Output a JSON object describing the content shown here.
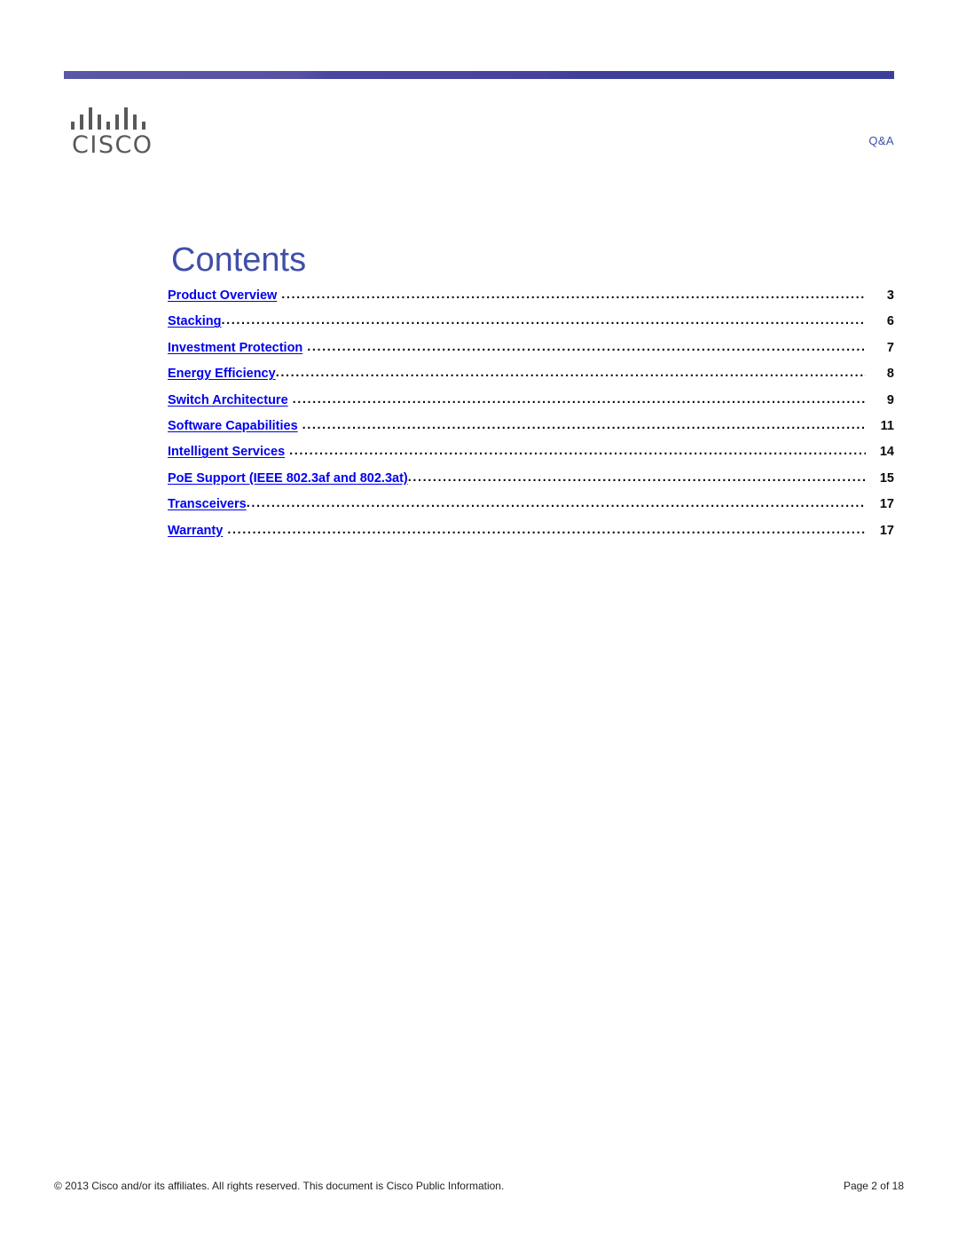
{
  "header": {
    "logo_wordmark": "CISCO",
    "logo_name": "cisco-logo",
    "doc_kind": "Q&A"
  },
  "title": "Contents",
  "toc": {
    "entries": [
      {
        "label": "Product Overview",
        "page": "3"
      },
      {
        "label": "Stacking",
        "page": "6"
      },
      {
        "label": "Investment Protection",
        "page": "7"
      },
      {
        "label": "Energy Efficiency",
        "page": "8"
      },
      {
        "label": "Switch Architecture",
        "page": "9"
      },
      {
        "label": "Software Capabilities",
        "page": "11"
      },
      {
        "label": "Intelligent Services",
        "page": "14"
      },
      {
        "label": "PoE Support (IEEE 802.3af and 802.3at)",
        "page": "15"
      },
      {
        "label": "Transceivers",
        "page": "17"
      },
      {
        "label": "Warranty",
        "page": "17"
      }
    ]
  },
  "footer": {
    "copyright": "© 2013 Cisco and/or its affiliates. All rights reserved. This document is Cisco Public Information.",
    "page_indicator": "Page 2 of 18"
  },
  "colors": {
    "rule_start": "#5b57a6",
    "rule_end": "#3b3f9a",
    "title_blue": "#3f4ea9",
    "link_blue": "#0000ee",
    "logo_gray": "#58595b",
    "text_black": "#231f20"
  }
}
